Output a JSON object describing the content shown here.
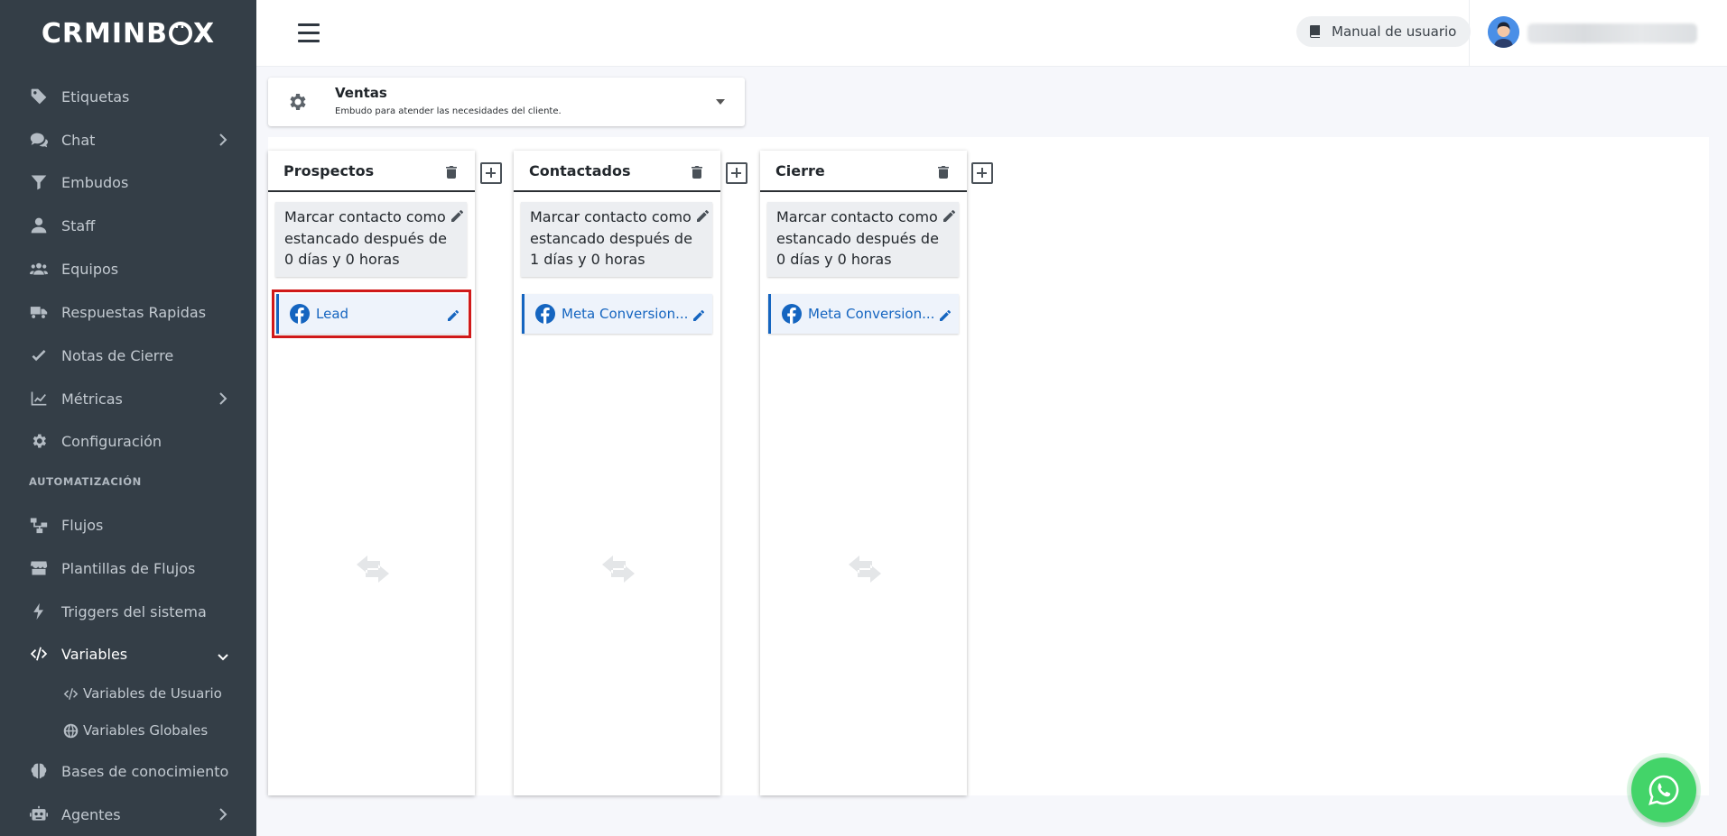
{
  "app": {
    "logo_text_1": "CRMINB",
    "logo_text_2": "X"
  },
  "sidebar": {
    "items": [
      {
        "label": "Etiquetas",
        "icon": "tag-icon",
        "has_chevron": false
      },
      {
        "label": "Chat",
        "icon": "chat-icon",
        "has_chevron": true
      },
      {
        "label": "Embudos",
        "icon": "funnel-icon",
        "has_chevron": false
      },
      {
        "label": "Staff",
        "icon": "user-icon",
        "has_chevron": false
      },
      {
        "label": "Equipos",
        "icon": "team-icon",
        "has_chevron": false
      },
      {
        "label": "Respuestas Rapidas",
        "icon": "truck-icon",
        "has_chevron": false
      },
      {
        "label": "Notas de Cierre",
        "icon": "check-icon",
        "has_chevron": false
      },
      {
        "label": "Métricas",
        "icon": "chart-icon",
        "has_chevron": true
      },
      {
        "label": "Configuración",
        "icon": "gear-icon",
        "has_chevron": false
      }
    ],
    "section_label": "AUTOMATIZACIÓN",
    "automation_items": [
      {
        "label": "Flujos",
        "icon": "flow-icon"
      },
      {
        "label": "Plantillas de Flujos",
        "icon": "store-icon"
      },
      {
        "label": "Triggers del sistema",
        "icon": "bolt-icon"
      },
      {
        "label": "Variables",
        "icon": "code-icon",
        "active": true
      }
    ],
    "sub_items": [
      {
        "label": "Variables de Usuario",
        "icon": "code-icon"
      },
      {
        "label": "Variables Globales",
        "icon": "globe-icon"
      }
    ],
    "bottom_items": [
      {
        "label": "Bases de conocimiento",
        "icon": "brain-icon"
      },
      {
        "label": "Agentes",
        "icon": "robot-icon"
      }
    ]
  },
  "topbar": {
    "manual_label": "Manual de usuario"
  },
  "funnel": {
    "name": "Ventas",
    "description": "Embudo para atender las necesidades del cliente."
  },
  "columns": [
    {
      "title": "Prospectos",
      "stall_text": "Marcar contacto como estancado después de 0 días y 0 horas",
      "trigger_label": "Lead"
    },
    {
      "title": "Contactados",
      "stall_text": "Marcar contacto como estancado después de 1 días y 0 horas",
      "trigger_label": "Meta Conversion..."
    },
    {
      "title": "Cierre",
      "stall_text": "Marcar contacto como estancado después de 0 días y 0 horas",
      "trigger_label": "Meta Conversion..."
    }
  ],
  "colors": {
    "sidebar_bg": "#343e47",
    "accent_blue": "#1565c0",
    "highlight_red": "#d01919",
    "whatsapp_green": "#43d469"
  }
}
